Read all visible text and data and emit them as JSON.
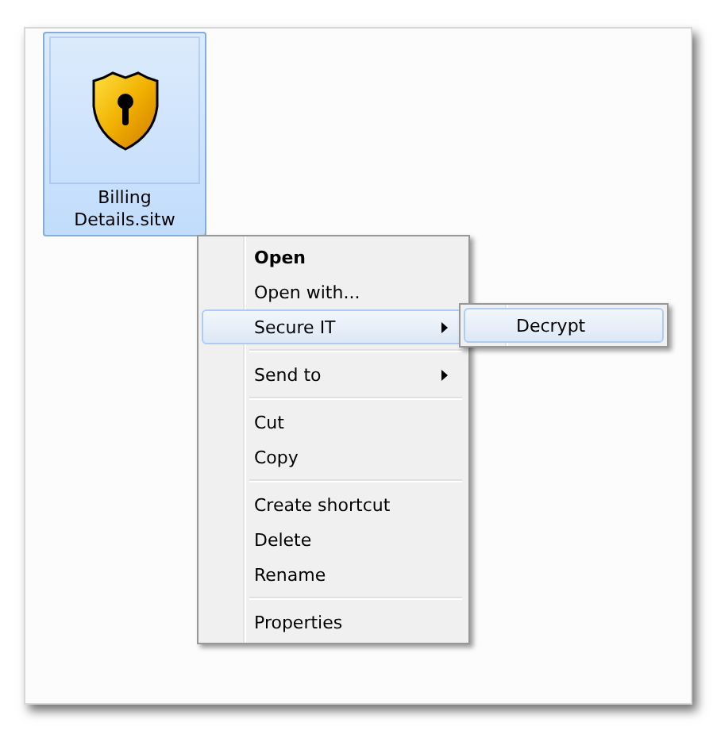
{
  "file": {
    "name": "Billing Details.sitw",
    "selected": true
  },
  "context_menu": {
    "items": [
      {
        "kind": "item",
        "label": "Open",
        "default": true,
        "selected": false,
        "submenu": false
      },
      {
        "kind": "item",
        "label": "Open with...",
        "default": false,
        "selected": false,
        "submenu": false
      },
      {
        "kind": "item",
        "label": "Secure IT",
        "default": false,
        "selected": true,
        "submenu": true
      },
      {
        "kind": "separator"
      },
      {
        "kind": "item",
        "label": "Send to",
        "default": false,
        "selected": false,
        "submenu": true
      },
      {
        "kind": "separator"
      },
      {
        "kind": "item",
        "label": "Cut",
        "default": false,
        "selected": false,
        "submenu": false
      },
      {
        "kind": "item",
        "label": "Copy",
        "default": false,
        "selected": false,
        "submenu": false
      },
      {
        "kind": "separator"
      },
      {
        "kind": "item",
        "label": "Create shortcut",
        "default": false,
        "selected": false,
        "submenu": false
      },
      {
        "kind": "item",
        "label": "Delete",
        "default": false,
        "selected": false,
        "submenu": false
      },
      {
        "kind": "item",
        "label": "Rename",
        "default": false,
        "selected": false,
        "submenu": false
      },
      {
        "kind": "separator"
      },
      {
        "kind": "item",
        "label": "Properties",
        "default": false,
        "selected": false,
        "submenu": false
      }
    ]
  },
  "submenu": {
    "items": [
      {
        "kind": "item",
        "label": "Decrypt",
        "selected": true
      }
    ]
  }
}
